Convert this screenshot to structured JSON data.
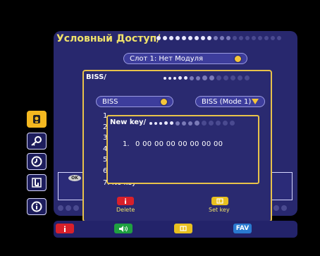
{
  "main": {
    "title": "Условный Доступ/",
    "slot_label": "Слот 1: Нет Модуля"
  },
  "sidebar": {
    "icons": [
      "cam-icon",
      "key-icon",
      "clock-icon",
      "settings-icon",
      "info-icon"
    ],
    "active": "cam-icon"
  },
  "biss": {
    "title": "BISS/",
    "toggle_label": "BISS",
    "mode_label": "BISS (Mode 1)",
    "list_numbers": [
      "1",
      "2",
      "3",
      "4",
      "5",
      "6"
    ],
    "row7": "7. No key",
    "delete_label": "Delete",
    "setkey_label": "Set key"
  },
  "newkey": {
    "title": "New key/",
    "index": "1.",
    "value": "0 00 00 00 00 00 00 00"
  },
  "ok_badge": "OK",
  "bottom_bar": {
    "fav_label": "FAV"
  },
  "colors": {
    "panel": "#28286e",
    "accent_yellow": "#f5c53a",
    "border_gold": "#e8c24a",
    "red": "#d8202a",
    "green": "#1fa040",
    "yellow": "#e8c020",
    "blue": "#2a7ad0"
  }
}
